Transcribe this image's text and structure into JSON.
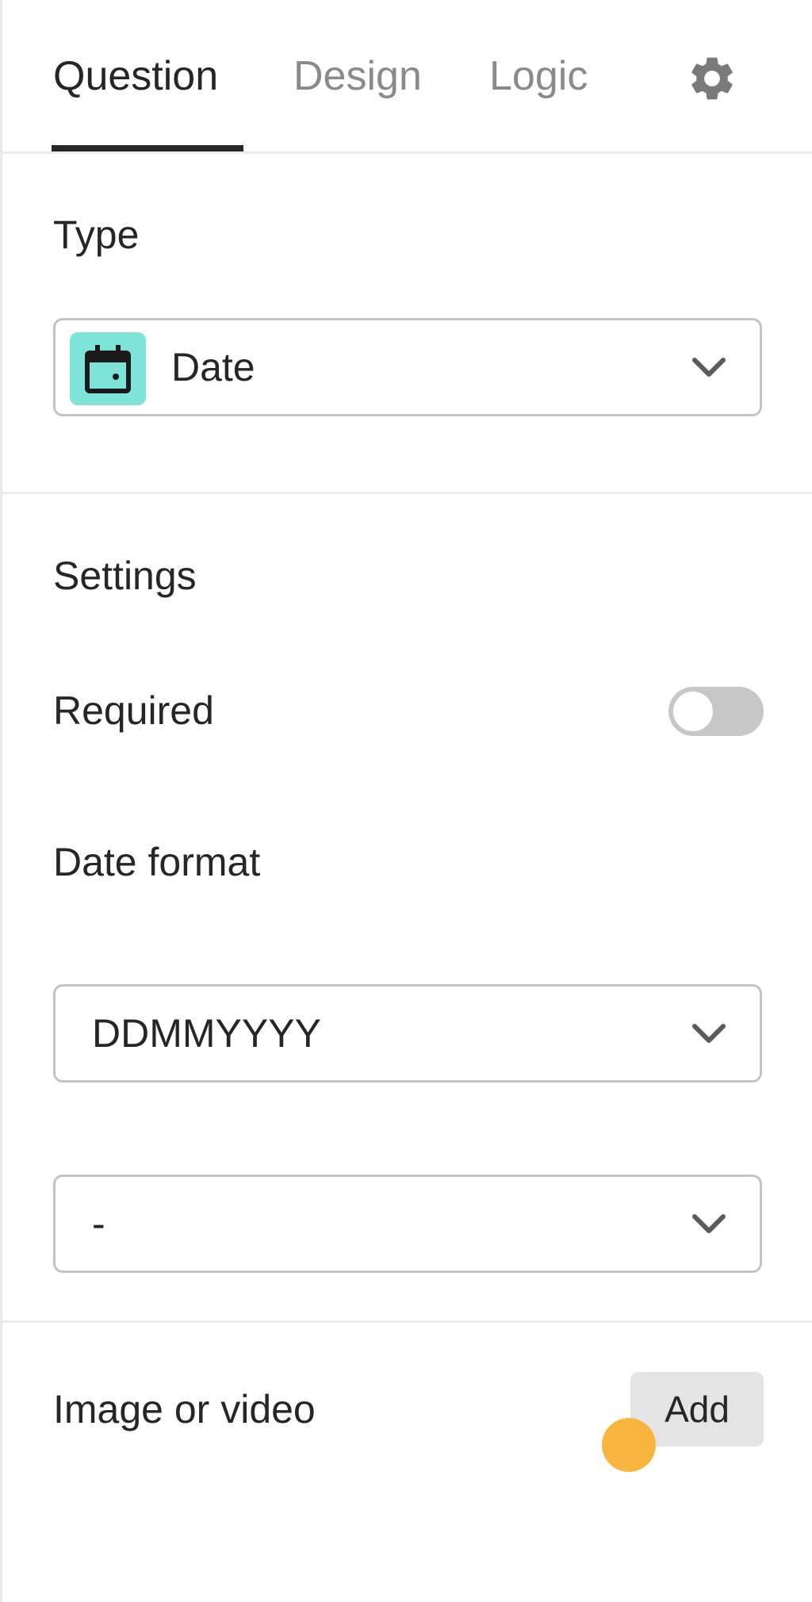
{
  "tabs": [
    {
      "label": "Question",
      "active": true
    },
    {
      "label": "Design",
      "active": false
    },
    {
      "label": "Logic",
      "active": false
    }
  ],
  "settings_icon": "gear-icon",
  "type_section": {
    "title": "Type",
    "selected": "Date",
    "icon": "calendar-icon",
    "icon_bg": "#7ee3d8"
  },
  "settings_section": {
    "title": "Settings",
    "required_label": "Required",
    "required_on": false,
    "date_format_label": "Date format",
    "date_format_value": "DDMMYYYY",
    "separator_value": "-"
  },
  "media_section": {
    "title": "Image or video",
    "add_label": "Add"
  },
  "colors": {
    "text": "#262627",
    "muted": "#8a8a8a",
    "accent_cursor": "#f9b234"
  }
}
